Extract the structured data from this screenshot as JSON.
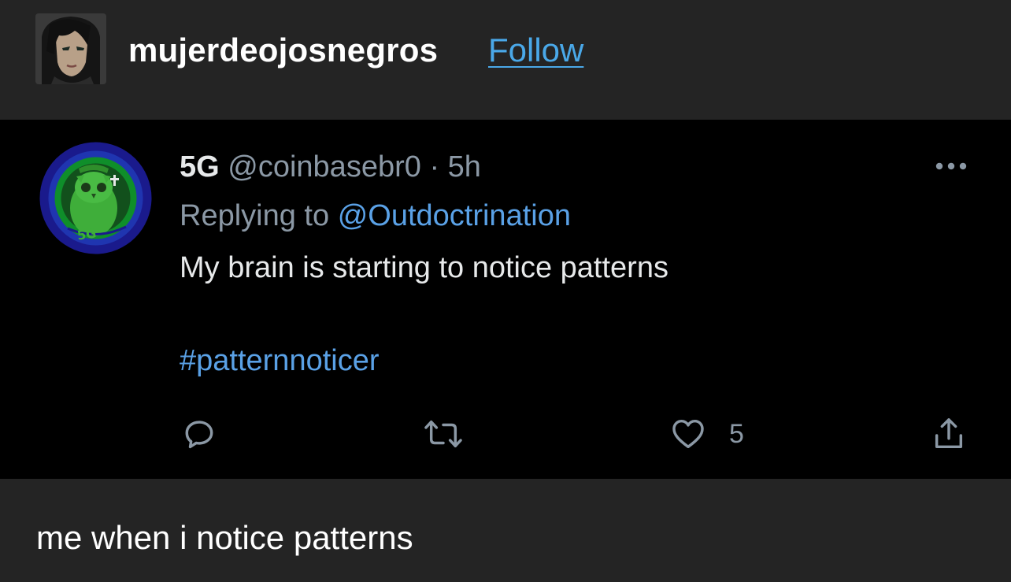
{
  "post": {
    "username": "mujerdeojosnegros",
    "follow_label": "Follow",
    "caption": "me when i notice patterns",
    "colors": {
      "background": "#242424",
      "follow_link": "#4aa8e8"
    }
  },
  "tweet": {
    "display_name": "5G",
    "handle": "@coinbasebr0",
    "separator": "·",
    "time": "5h",
    "reply_prefix": "Replying to",
    "reply_to": "@Outdoctrination",
    "text": "My brain is starting to notice patterns",
    "hashtag": "#patternnoticer",
    "avatar_badge_text": "5G",
    "like_count": "5",
    "icons": {
      "more": "more-horizontal-icon",
      "reply": "reply-icon",
      "retweet": "retweet-icon",
      "like": "heart-icon",
      "share": "share-icon"
    },
    "colors": {
      "background": "#000000",
      "link": "#5aa1e6",
      "secondary_text": "#8b98a5"
    }
  }
}
